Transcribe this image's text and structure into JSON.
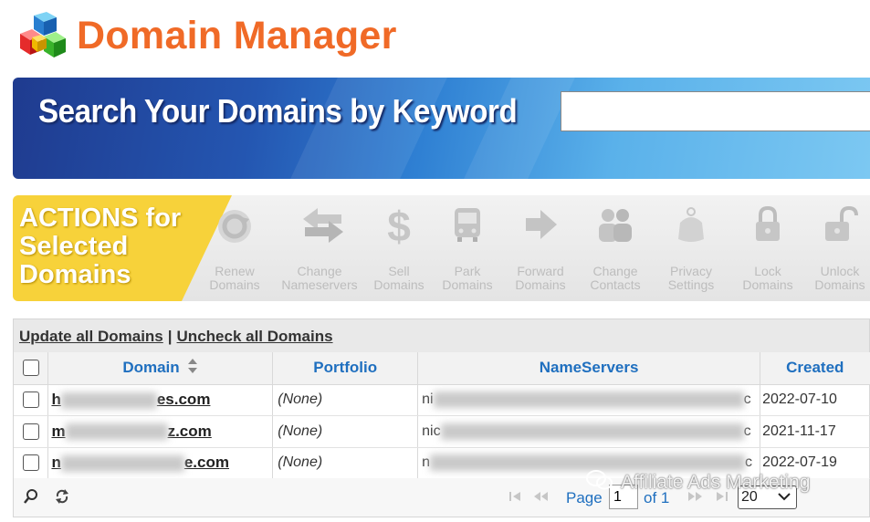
{
  "header": {
    "title": "Domain Manager",
    "logo_icon": "colored-cubes-icon"
  },
  "search": {
    "banner_text": "Search Your Domains by Keyword",
    "value": ""
  },
  "actions": {
    "title_line1": "ACTIONS for",
    "title_line2": "Selected",
    "title_line3": "Domains",
    "items": [
      {
        "line1": "Renew",
        "line2": "Domains",
        "icon": "renew-icon"
      },
      {
        "line1": "Change",
        "line2": "Nameservers",
        "icon": "swap-arrows-icon"
      },
      {
        "line1": "Sell",
        "line2": "Domains",
        "icon": "dollar-icon"
      },
      {
        "line1": "Park",
        "line2": "Domains",
        "icon": "bus-icon"
      },
      {
        "line1": "Forward",
        "line2": "Domains",
        "icon": "arrow-right-icon"
      },
      {
        "line1": "Change",
        "line2": "Contacts",
        "icon": "people-icon"
      },
      {
        "line1": "Privacy",
        "line2": "Settings",
        "icon": "privacy-tag-icon"
      },
      {
        "line1": "Lock",
        "line2": "Domains",
        "icon": "lock-icon"
      },
      {
        "line1": "Unlock",
        "line2": "Domains",
        "icon": "unlock-icon"
      }
    ]
  },
  "grid": {
    "update_all_label": "Update all Domains",
    "separator": "|",
    "uncheck_all_label": "Uncheck all Domains",
    "columns": {
      "domain": "Domain",
      "portfolio": "Portfolio",
      "nameservers": "NameServers",
      "created": "Created"
    },
    "rows": [
      {
        "domain_start": "h",
        "domain_end": "es.com",
        "portfolio": "(None)",
        "ns_start": "ni",
        "ns_end": "c",
        "created": "2022-07-10"
      },
      {
        "domain_start": "m",
        "domain_end": "z.com",
        "portfolio": "(None)",
        "ns_start": "nic",
        "ns_end": "c",
        "created": "2021-11-17"
      },
      {
        "domain_start": "n",
        "domain_end": "e.com",
        "portfolio": "(None)",
        "ns_start": "n",
        "ns_end": "c",
        "created": "2022-07-19"
      }
    ],
    "pager": {
      "page_label": "Page",
      "page_value": "1",
      "of_label": "of 1",
      "rows_per_page": "20"
    }
  },
  "watermark": {
    "text": "Affiliate Ads Marketing"
  },
  "colors": {
    "brand_orange": "#f06a27",
    "link_blue": "#1f6fbf",
    "actions_yellow": "#f7d23a"
  }
}
